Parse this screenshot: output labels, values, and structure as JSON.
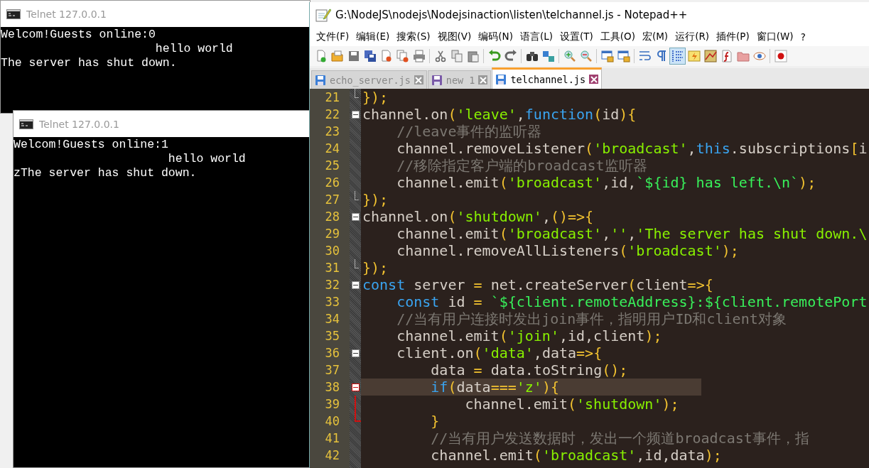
{
  "telnet_windows": [
    {
      "title": "Telnet 127.0.0.1",
      "active": false,
      "lines": [
        "Welcom!Guests online:0",
        "                      hello world",
        "The server has shut down."
      ]
    },
    {
      "title": "Telnet 127.0.0.1",
      "active": false,
      "lines": [
        "Welcom!Guests online:1",
        "                      hello world",
        "zThe server has shut down."
      ]
    }
  ],
  "editor": {
    "title": "G:\\NodeJS\\nodejs\\Nodejsinaction\\listen\\telchannel.js - Notepad++",
    "menu": [
      "文件(F)",
      "编辑(E)",
      "搜索(S)",
      "视图(V)",
      "编码(N)",
      "语言(L)",
      "设置(T)",
      "工具(O)",
      "宏(M)",
      "运行(R)",
      "插件(P)",
      "窗口(W)",
      "?"
    ],
    "toolbar": [
      [
        {
          "kind": "new",
          "pressed": false
        },
        {
          "kind": "open",
          "pressed": false
        },
        {
          "kind": "save",
          "pressed": false
        },
        {
          "kind": "save_all",
          "pressed": false
        },
        {
          "kind": "close",
          "pressed": false
        },
        {
          "kind": "close_all",
          "pressed": false
        },
        {
          "kind": "print",
          "pressed": false
        }
      ],
      [
        {
          "kind": "cut",
          "pressed": false
        },
        {
          "kind": "copy",
          "pressed": false
        },
        {
          "kind": "paste",
          "pressed": false
        }
      ],
      [
        {
          "kind": "undo",
          "pressed": false
        },
        {
          "kind": "redo",
          "pressed": false
        }
      ],
      [
        {
          "kind": "find",
          "pressed": false
        },
        {
          "kind": "replace",
          "pressed": false
        }
      ],
      [
        {
          "kind": "zoom_in",
          "pressed": false
        },
        {
          "kind": "zoom_out",
          "pressed": false
        }
      ],
      [
        {
          "kind": "sync_v",
          "pressed": false
        },
        {
          "kind": "sync_h",
          "pressed": false
        }
      ],
      [
        {
          "kind": "wrap",
          "pressed": false
        },
        {
          "kind": "pilcrow",
          "pressed": false
        },
        {
          "kind": "indent_guide",
          "pressed": true
        },
        {
          "kind": "lang",
          "pressed": false
        },
        {
          "kind": "map",
          "pressed": false
        },
        {
          "kind": "function",
          "pressed": false
        },
        {
          "kind": "folder",
          "pressed": false
        },
        {
          "kind": "eye",
          "pressed": false
        }
      ],
      [
        {
          "kind": "record",
          "pressed": false
        }
      ]
    ],
    "tabs": [
      {
        "label": "echo_server.js",
        "selected": false,
        "color": "#3d7fd6"
      },
      {
        "label": "new 1",
        "selected": false,
        "color": "#7a5aa8"
      },
      {
        "label": "telchannel.js",
        "selected": true,
        "color": "#3d7fd6"
      }
    ],
    "lines": [
      {
        "number": "21",
        "kind": "fold_end",
        "current": false,
        "tokens": [
          {
            "text": "});",
            "kind": "punct"
          }
        ]
      },
      {
        "number": "22",
        "kind": "fold_start",
        "current": false,
        "tokens": [
          {
            "text": "channel.on",
            "kind": "plain"
          },
          {
            "text": "(",
            "kind": "punct"
          },
          {
            "text": "'leave'",
            "kind": "string"
          },
          {
            "text": ",",
            "kind": "plain"
          },
          {
            "text": "function",
            "kind": "keyword"
          },
          {
            "text": "(",
            "kind": "punct"
          },
          {
            "text": "id",
            "kind": "plain"
          },
          {
            "text": "){",
            "kind": "punct"
          }
        ]
      },
      {
        "number": "23",
        "kind": "plain",
        "current": false,
        "tokens": [
          {
            "text": "    //leave事件的监听器",
            "kind": "comment"
          }
        ]
      },
      {
        "number": "24",
        "kind": "plain",
        "current": false,
        "tokens": [
          {
            "text": "    channel.removeListener",
            "kind": "plain"
          },
          {
            "text": "(",
            "kind": "punct"
          },
          {
            "text": "'broadcast'",
            "kind": "string"
          },
          {
            "text": ",",
            "kind": "plain"
          },
          {
            "text": "this",
            "kind": "keyword"
          },
          {
            "text": ".subscriptions",
            "kind": "plain"
          },
          {
            "text": "[",
            "kind": "punct"
          },
          {
            "text": "i",
            "kind": "plain"
          }
        ]
      },
      {
        "number": "25",
        "kind": "plain",
        "current": false,
        "tokens": [
          {
            "text": "    //移除指定客户端的broadcast监听器",
            "kind": "comment"
          }
        ]
      },
      {
        "number": "26",
        "kind": "plain",
        "current": false,
        "tokens": [
          {
            "text": "    channel.emit",
            "kind": "plain"
          },
          {
            "text": "(",
            "kind": "punct"
          },
          {
            "text": "'broadcast'",
            "kind": "string"
          },
          {
            "text": ",id,",
            "kind": "plain"
          },
          {
            "text": "`${id} has left.\\n`",
            "kind": "template"
          },
          {
            "text": ");",
            "kind": "punct"
          }
        ]
      },
      {
        "number": "27",
        "kind": "fold_end",
        "current": false,
        "tokens": [
          {
            "text": "});",
            "kind": "punct"
          }
        ]
      },
      {
        "number": "28",
        "kind": "fold_start",
        "current": false,
        "tokens": [
          {
            "text": "channel.on",
            "kind": "plain"
          },
          {
            "text": "(",
            "kind": "punct"
          },
          {
            "text": "'shutdown'",
            "kind": "string"
          },
          {
            "text": ",",
            "kind": "plain"
          },
          {
            "text": "()=>{",
            "kind": "punct"
          }
        ]
      },
      {
        "number": "29",
        "kind": "plain",
        "current": false,
        "tokens": [
          {
            "text": "    channel.emit",
            "kind": "plain"
          },
          {
            "text": "(",
            "kind": "punct"
          },
          {
            "text": "'broadcast'",
            "kind": "string"
          },
          {
            "text": ",",
            "kind": "plain"
          },
          {
            "text": "''",
            "kind": "string"
          },
          {
            "text": ",",
            "kind": "plain"
          },
          {
            "text": "'The server has shut down.\\",
            "kind": "string"
          }
        ]
      },
      {
        "number": "30",
        "kind": "plain",
        "current": false,
        "tokens": [
          {
            "text": "    channel.removeAllListeners",
            "kind": "plain"
          },
          {
            "text": "(",
            "kind": "punct"
          },
          {
            "text": "'broadcast'",
            "kind": "string"
          },
          {
            "text": ");",
            "kind": "punct"
          }
        ]
      },
      {
        "number": "31",
        "kind": "fold_end",
        "current": false,
        "tokens": [
          {
            "text": "});",
            "kind": "punct"
          }
        ]
      },
      {
        "number": "32",
        "kind": "fold_start",
        "current": false,
        "tokens": [
          {
            "text": "const",
            "kind": "keyword"
          },
          {
            "text": " server ",
            "kind": "plain"
          },
          {
            "text": "=",
            "kind": "punct"
          },
          {
            "text": " net.createServer",
            "kind": "plain"
          },
          {
            "text": "(",
            "kind": "punct"
          },
          {
            "text": "client",
            "kind": "plain"
          },
          {
            "text": "=>{",
            "kind": "punct"
          }
        ]
      },
      {
        "number": "33",
        "kind": "plain",
        "current": false,
        "tokens": [
          {
            "text": "    const",
            "kind": "keyword"
          },
          {
            "text": " id ",
            "kind": "plain"
          },
          {
            "text": "=",
            "kind": "punct"
          },
          {
            "text": " `${client.remoteAddress}:${client.remotePort",
            "kind": "template"
          }
        ]
      },
      {
        "number": "34",
        "kind": "plain",
        "current": false,
        "tokens": [
          {
            "text": "    //当有用户连接时发出join事件，指明用户ID和client对象",
            "kind": "comment"
          }
        ]
      },
      {
        "number": "35",
        "kind": "plain",
        "current": false,
        "tokens": [
          {
            "text": "    channel.emit",
            "kind": "plain"
          },
          {
            "text": "(",
            "kind": "punct"
          },
          {
            "text": "'join'",
            "kind": "string"
          },
          {
            "text": ",id,client",
            "kind": "plain"
          },
          {
            "text": ");",
            "kind": "punct"
          }
        ]
      },
      {
        "number": "36",
        "kind": "fold_start",
        "current": false,
        "tokens": [
          {
            "text": "    client.on",
            "kind": "plain"
          },
          {
            "text": "(",
            "kind": "punct"
          },
          {
            "text": "'data'",
            "kind": "string"
          },
          {
            "text": ",data",
            "kind": "plain"
          },
          {
            "text": "=>{",
            "kind": "punct"
          }
        ]
      },
      {
        "number": "37",
        "kind": "plain",
        "current": false,
        "tokens": [
          {
            "text": "        data ",
            "kind": "plain"
          },
          {
            "text": "=",
            "kind": "punct"
          },
          {
            "text": " data.toString",
            "kind": "plain"
          },
          {
            "text": "();",
            "kind": "punct"
          }
        ]
      },
      {
        "number": "38",
        "kind": "fold_start",
        "current": true,
        "tokens": [
          {
            "text": "        if",
            "kind": "keyword"
          },
          {
            "text": "(",
            "kind": "punct"
          },
          {
            "text": "data",
            "kind": "plain"
          },
          {
            "text": "===",
            "kind": "punct"
          },
          {
            "text": "'z'",
            "kind": "string"
          },
          {
            "text": "){",
            "kind": "punct"
          }
        ]
      },
      {
        "number": "39",
        "kind": "fold_inner_active",
        "current": false,
        "tokens": [
          {
            "text": "            channel.emit",
            "kind": "plain"
          },
          {
            "text": "(",
            "kind": "punct"
          },
          {
            "text": "'shutdown'",
            "kind": "string"
          },
          {
            "text": ");",
            "kind": "punct"
          }
        ]
      },
      {
        "number": "40",
        "kind": "fold_end_active",
        "current": false,
        "tokens": [
          {
            "text": "        }",
            "kind": "punct"
          }
        ]
      },
      {
        "number": "41",
        "kind": "plain",
        "current": false,
        "tokens": [
          {
            "text": "        //当有用户发送数据时，发出一个频道broadcast事件，指",
            "kind": "comment"
          }
        ]
      },
      {
        "number": "42",
        "kind": "plain",
        "current": false,
        "tokens": [
          {
            "text": "        channel.emit",
            "kind": "plain"
          },
          {
            "text": "(",
            "kind": "punct"
          },
          {
            "text": "'broadcast'",
            "kind": "string"
          },
          {
            "text": ",id,data",
            "kind": "plain"
          },
          {
            "text": ");",
            "kind": "punct"
          }
        ]
      }
    ]
  }
}
